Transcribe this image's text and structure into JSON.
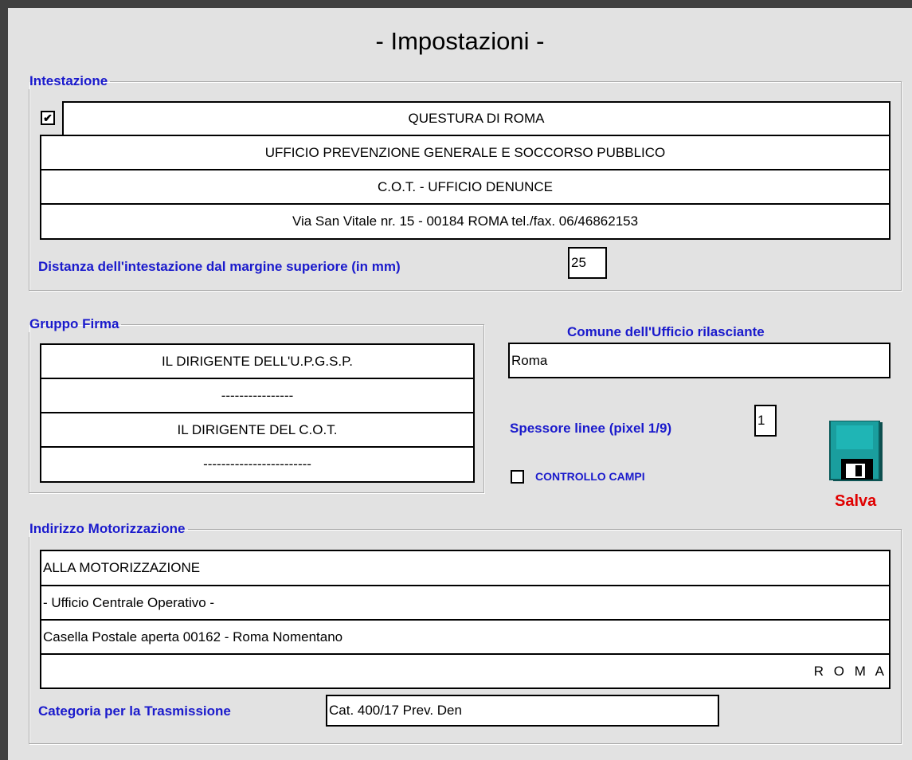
{
  "window": {
    "title": "- Impostazioni -"
  },
  "intestazione": {
    "legend": "Intestazione",
    "checkbox_checked": true,
    "checkbox_glyph": "✔",
    "lines": [
      "QUESTURA DI ROMA",
      "UFFICIO PREVENZIONE GENERALE E SOCCORSO PUBBLICO",
      "C.O.T. - UFFICIO DENUNCE",
      "Via San Vitale nr. 15 - 00184 ROMA tel./fax. 06/46862153"
    ],
    "distanza_label": "Distanza dell'intestazione dal margine superiore (in mm)",
    "distanza_value": "25"
  },
  "gruppo_firma": {
    "legend": "Gruppo Firma",
    "lines": [
      "IL DIRIGENTE DELL'U.P.G.S.P.",
      "----------------",
      "IL DIRIGENTE DEL C.O.T.",
      "------------------------"
    ]
  },
  "comune": {
    "label": "Comune dell'Ufficio rilasciante",
    "value": "Roma"
  },
  "spessore": {
    "label": "Spessore linee (pixel 1/9)",
    "value": "1"
  },
  "controllo_campi": {
    "label": "CONTROLLO CAMPI",
    "checked": false
  },
  "salva": {
    "label": "Salva",
    "icon": "floppy-disk-icon",
    "colors": {
      "disk": "#1a9e9e",
      "label": "#e00000"
    }
  },
  "motorizzazione": {
    "legend": "Indirizzo Motorizzazione",
    "lines": [
      "ALLA MOTORIZZAZIONE",
      "- Ufficio Centrale Operativo -",
      "Casella Postale aperta 00162 - Roma Nomentano",
      "R O M A"
    ]
  },
  "categoria": {
    "label": "Categoria per la Trasmissione",
    "value": "Cat. 400/17 Prev. Den"
  },
  "colors": {
    "accent_label": "#1a1acc",
    "background": "#e2e2e2"
  }
}
